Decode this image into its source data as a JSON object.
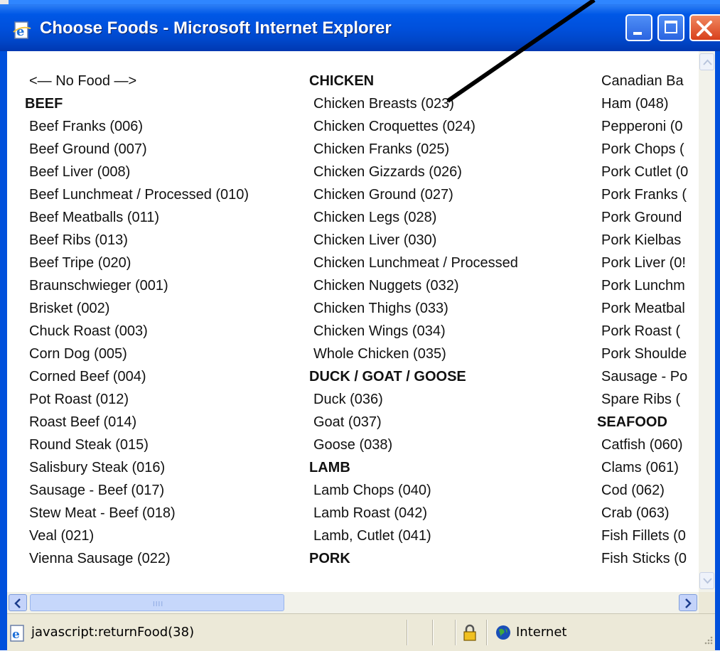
{
  "window": {
    "title": "Choose Foods - Microsoft Internet Explorer",
    "icon": "ie-page-icon",
    "controls": [
      "minimize-icon",
      "maximize-icon",
      "close-icon"
    ]
  },
  "columns": {
    "col1": [
      {
        "text": "<— No Food —>",
        "type": "link"
      },
      {
        "text": "BEEF",
        "type": "category"
      },
      {
        "text": "Beef Franks (006)",
        "type": "link"
      },
      {
        "text": "Beef Ground (007)",
        "type": "link"
      },
      {
        "text": "Beef Liver (008)",
        "type": "link"
      },
      {
        "text": "Beef Lunchmeat / Processed (010)",
        "type": "link"
      },
      {
        "text": "Beef Meatballs (011)",
        "type": "link"
      },
      {
        "text": "Beef Ribs (013)",
        "type": "link"
      },
      {
        "text": "Beef Tripe (020)",
        "type": "link"
      },
      {
        "text": "Braunschwieger (001)",
        "type": "link"
      },
      {
        "text": "Brisket (002)",
        "type": "link"
      },
      {
        "text": "Chuck Roast (003)",
        "type": "link"
      },
      {
        "text": "Corn Dog (005)",
        "type": "link"
      },
      {
        "text": "Corned Beef (004)",
        "type": "link"
      },
      {
        "text": "Pot Roast (012)",
        "type": "link"
      },
      {
        "text": "Roast Beef (014)",
        "type": "link"
      },
      {
        "text": "Round Steak (015)",
        "type": "link"
      },
      {
        "text": "Salisbury Steak (016)",
        "type": "link"
      },
      {
        "text": "Sausage - Beef (017)",
        "type": "link"
      },
      {
        "text": "Stew Meat - Beef (018)",
        "type": "link"
      },
      {
        "text": "Veal (021)",
        "type": "link"
      },
      {
        "text": "Vienna Sausage (022)",
        "type": "link"
      }
    ],
    "col2": [
      {
        "text": "CHICKEN",
        "type": "category"
      },
      {
        "text": "Chicken Breasts (023)",
        "type": "link"
      },
      {
        "text": "Chicken Croquettes (024)",
        "type": "link"
      },
      {
        "text": "Chicken Franks (025)",
        "type": "link"
      },
      {
        "text": "Chicken Gizzards (026)",
        "type": "link"
      },
      {
        "text": "Chicken Ground (027)",
        "type": "link"
      },
      {
        "text": "Chicken Legs (028)",
        "type": "link"
      },
      {
        "text": "Chicken Liver (030)",
        "type": "link"
      },
      {
        "text": "Chicken Lunchmeat / Processed",
        "type": "link"
      },
      {
        "text": "Chicken Nuggets (032)",
        "type": "link"
      },
      {
        "text": "Chicken Thighs (033)",
        "type": "link"
      },
      {
        "text": "Chicken Wings (034)",
        "type": "link"
      },
      {
        "text": "Whole Chicken (035)",
        "type": "link"
      },
      {
        "text": "DUCK / GOAT / GOOSE",
        "type": "category"
      },
      {
        "text": "Duck (036)",
        "type": "link"
      },
      {
        "text": "Goat (037)",
        "type": "link"
      },
      {
        "text": "Goose (038)",
        "type": "link"
      },
      {
        "text": "LAMB",
        "type": "category"
      },
      {
        "text": "Lamb Chops (040)",
        "type": "link"
      },
      {
        "text": "Lamb Roast (042)",
        "type": "link"
      },
      {
        "text": "Lamb, Cutlet (041)",
        "type": "link"
      },
      {
        "text": "PORK",
        "type": "category"
      }
    ],
    "col3": [
      {
        "text": "Canadian Ba",
        "type": "link"
      },
      {
        "text": "Ham (048)",
        "type": "link"
      },
      {
        "text": "Pepperoni (0",
        "type": "link"
      },
      {
        "text": "Pork Chops (",
        "type": "link"
      },
      {
        "text": "Pork Cutlet (0",
        "type": "link"
      },
      {
        "text": "Pork Franks (",
        "type": "link"
      },
      {
        "text": "Pork Ground",
        "type": "link"
      },
      {
        "text": "Pork Kielbas",
        "type": "link"
      },
      {
        "text": "Pork Liver (0!",
        "type": "link"
      },
      {
        "text": "Pork Lunchm",
        "type": "link"
      },
      {
        "text": "Pork Meatbal",
        "type": "link"
      },
      {
        "text": "Pork Roast (",
        "type": "link"
      },
      {
        "text": "Pork Shoulde",
        "type": "link"
      },
      {
        "text": "Sausage - Po",
        "type": "link"
      },
      {
        "text": "Spare Ribs (",
        "type": "link"
      },
      {
        "text": "SEAFOOD",
        "type": "category"
      },
      {
        "text": "Catfish (060)",
        "type": "link"
      },
      {
        "text": "Clams (061)",
        "type": "link"
      },
      {
        "text": "Cod (062)",
        "type": "link"
      },
      {
        "text": "Crab (063)",
        "type": "link"
      },
      {
        "text": "Fish Fillets (0",
        "type": "link"
      },
      {
        "text": "Fish Sticks (0",
        "type": "link"
      }
    ]
  },
  "scrollbars": {
    "horizontal_grip": "IIII"
  },
  "statusbar": {
    "text": "javascript:returnFood(38)",
    "zone": "Internet",
    "icons": [
      "ie-page-icon",
      "lock-icon",
      "globe-icon"
    ]
  },
  "colors": {
    "titlebar": "#0050dc",
    "close_button": "#e0502a",
    "statusbar": "#ece9d8"
  }
}
